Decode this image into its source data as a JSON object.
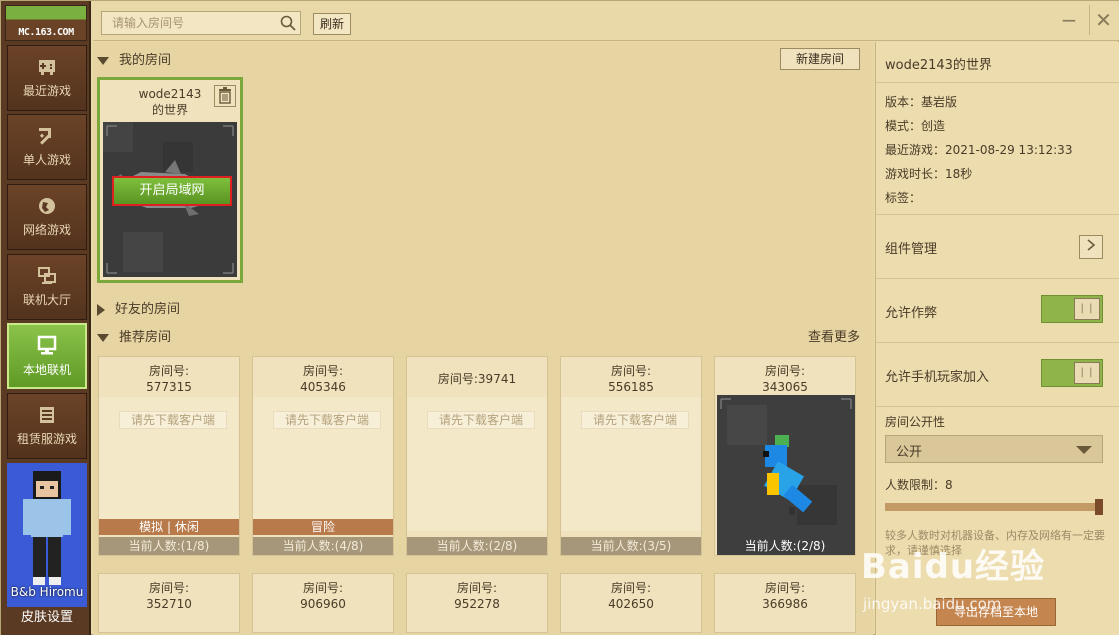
{
  "brand": {
    "logo_text": "MC.163.COM"
  },
  "sidebar": {
    "items": [
      {
        "label": "最近游戏"
      },
      {
        "label": "单人游戏"
      },
      {
        "label": "网络游戏"
      },
      {
        "label": "联机大厅"
      },
      {
        "label": "本地联机",
        "active": true
      },
      {
        "label": "租赁服游戏"
      }
    ],
    "skin": {
      "nickname": "B&b Hiromu",
      "settings_label": "皮肤设置"
    }
  },
  "topbar": {
    "search_placeholder": "请输入房间号",
    "refresh_label": "刷新",
    "minimize_glyph": "−",
    "close_glyph": "✕"
  },
  "my_rooms": {
    "header": "我的房间",
    "new_room_label": "新建房间",
    "room": {
      "name_line1": "wode2143",
      "name_line2": "的世界",
      "lan_button": "开启局域网"
    }
  },
  "friends": {
    "header": "好友的房间"
  },
  "recommended": {
    "header": "推荐房间",
    "more_label": "查看更多",
    "download_hint": "请先下载客户端",
    "cards": [
      {
        "id_label": "房间号:",
        "id": "577315",
        "tag": "模拟 | 休闲",
        "count": "当前人数:(1/8)"
      },
      {
        "id_label": "房间号:",
        "id": "405346",
        "tag": "冒险",
        "count": "当前人数:(4/8)"
      },
      {
        "id_label": "房间号:",
        "id": "39741",
        "tag": "",
        "count": "当前人数:(2/8)"
      },
      {
        "id_label": "房间号:",
        "id": "556185",
        "tag": "",
        "count": "当前人数:(3/5)"
      },
      {
        "id_label": "房间号:",
        "id": "343065",
        "tag": "",
        "count": "当前人数:(2/8)"
      }
    ],
    "cards_row2": [
      {
        "id_label": "房间号:",
        "id": "352710"
      },
      {
        "id_label": "房间号:",
        "id": "906960"
      },
      {
        "id_label": "房间号:",
        "id": "952278"
      },
      {
        "id_label": "房间号:",
        "id": "402650"
      },
      {
        "id_label": "房间号:",
        "id": "366986"
      }
    ]
  },
  "panel": {
    "title": "wode2143的世界",
    "version": "版本：基岩版",
    "mode": "模式：创造",
    "last_played": "最近游戏：2021-08-29 13:12:33",
    "play_time": "游戏时长：18秒",
    "tags": "标签：",
    "components_label": "组件管理",
    "cheat_label": "允许作弊",
    "cheat_on": true,
    "mobile_label": "允许手机玩家加入",
    "mobile_on": true,
    "visibility_label": "房间公开性",
    "visibility_value": "公开",
    "limit_label": "人数限制：8",
    "limit_fraction": 1.0,
    "hint": "较多人数时对机器设备、内存及网络有一定要求，请谨慎选择",
    "export_label": "导出存档至本地"
  },
  "watermark": {
    "line1": "Baidu经验",
    "line2": "jingyan.baidu.com"
  },
  "colors": {
    "accent_green": "#7aa83a",
    "sidebar_brown": "#5a3a22",
    "tag_orange": "#b87a4a",
    "highlight_red": "#e02020"
  }
}
